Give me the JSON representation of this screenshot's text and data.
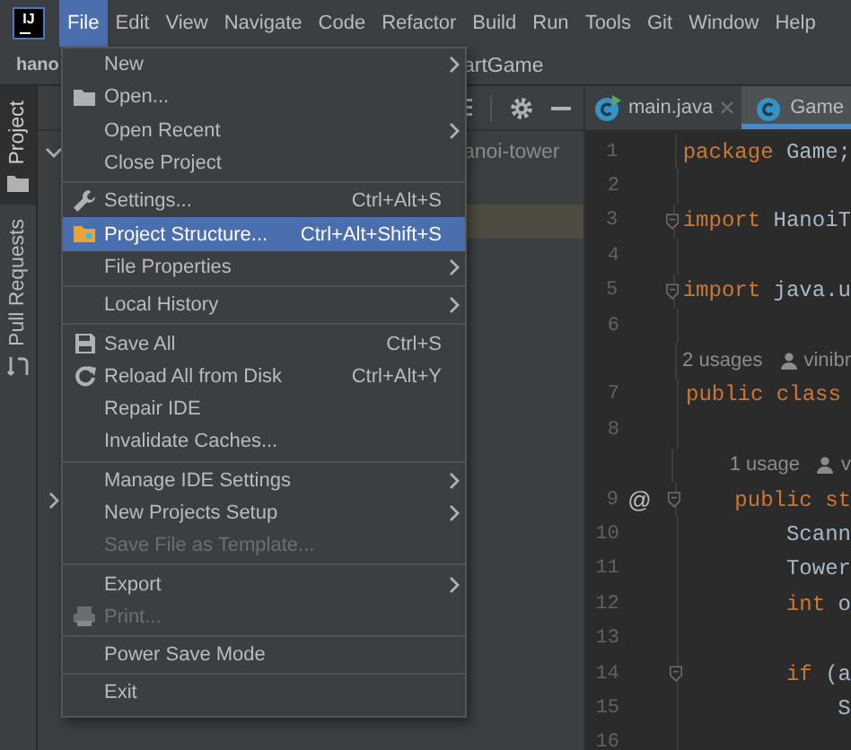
{
  "app": {
    "logo": "IJ"
  },
  "menu_bar": [
    {
      "label": "File",
      "selected": true
    },
    {
      "label": "Edit",
      "selected": false
    },
    {
      "label": "View",
      "selected": false
    },
    {
      "label": "Navigate",
      "selected": false
    },
    {
      "label": "Code",
      "selected": false
    },
    {
      "label": "Refactor",
      "selected": false
    },
    {
      "label": "Build",
      "selected": false
    },
    {
      "label": "Run",
      "selected": false
    },
    {
      "label": "Tools",
      "selected": false
    },
    {
      "label": "Git",
      "selected": false
    },
    {
      "label": "Window",
      "selected": false
    },
    {
      "label": "Help",
      "selected": false
    }
  ],
  "navigation_bar": {
    "project": "hano",
    "file": "artGame"
  },
  "tool_window_tabs": [
    {
      "label": "Project",
      "selected": true
    },
    {
      "label": "Pull Requests",
      "selected": false
    }
  ],
  "project_panel": {
    "rows": [
      {
        "label": "anoi-tower",
        "expanded": true,
        "selected": false
      },
      {
        "selected": false
      },
      {
        "selected": true
      },
      {
        "selected": false
      },
      {
        "selected": false
      },
      {
        "selected": false
      },
      {
        "selected": false
      },
      {
        "selected": false
      },
      {
        "selected": false
      },
      {
        "selected": false
      },
      {
        "expanded": false,
        "selected": false
      }
    ]
  },
  "editor": {
    "tabs": [
      {
        "label": "main.java",
        "selected": false,
        "runnable": true
      },
      {
        "label": "Game",
        "selected": true,
        "runnable": false
      }
    ],
    "lines": [
      {
        "kind": "code",
        "number": "1",
        "fold": false,
        "tokens": [
          {
            "text": "package",
            "kind": "keyword"
          },
          {
            "text": "Game;",
            "kind": "plain"
          }
        ]
      },
      {
        "kind": "code",
        "number": "2",
        "fold": false
      },
      {
        "kind": "code",
        "number": "3",
        "fold": true,
        "tokens": [
          {
            "text": "import",
            "kind": "keyword"
          },
          {
            "text": "HanoiT",
            "kind": "plain"
          }
        ]
      },
      {
        "kind": "code",
        "number": "4",
        "fold": false
      },
      {
        "kind": "code",
        "number": "5",
        "fold": true,
        "tokens": [
          {
            "text": "import",
            "kind": "keyword"
          },
          {
            "text": "java.u",
            "kind": "plain"
          }
        ]
      },
      {
        "kind": "code",
        "number": "6",
        "fold": false
      },
      {
        "kind": "hint",
        "usages": "2 usages",
        "author": "vinibr"
      },
      {
        "kind": "code",
        "number": "7",
        "fold": false,
        "tokens": [
          {
            "text": "public",
            "kind": "keyword"
          },
          {
            "text": "class",
            "kind": "keyword"
          }
        ],
        "children": [
          {
            "kind": "code",
            "number": "8",
            "fold": false
          },
          {
            "kind": "hint",
            "usages": "1 usage",
            "author": "v"
          },
          {
            "kind": "code",
            "number": "9",
            "fold": true,
            "annotation": "@",
            "tokens": [
              {
                "text": "public",
                "kind": "keyword"
              },
              {
                "text": "st",
                "kind": "keyword"
              }
            ],
            "children": [
              {
                "kind": "code",
                "number": "10",
                "fold": false,
                "tokens": [
                  {
                    "text": "Scann",
                    "kind": "plain"
                  }
                ]
              },
              {
                "kind": "code",
                "number": "11",
                "fold": false,
                "tokens": [
                  {
                    "text": "Tower",
                    "kind": "plain"
                  }
                ]
              },
              {
                "kind": "code",
                "number": "12",
                "fold": false,
                "tokens": [
                  {
                    "text": "int",
                    "kind": "keyword"
                  },
                  {
                    "text": "o",
                    "kind": "plain"
                  }
                ]
              },
              {
                "kind": "code",
                "number": "13",
                "fold": false
              },
              {
                "kind": "code",
                "number": "14",
                "fold": true,
                "tokens": [
                  {
                    "text": "if",
                    "kind": "keyword"
                  },
                  {
                    "text": "(a",
                    "kind": "plain"
                  }
                ],
                "children": [
                  {
                    "kind": "code",
                    "number": "15",
                    "fold": false,
                    "tokens": [
                      {
                        "text": "S",
                        "kind": "plain"
                      }
                    ]
                  },
                  {
                    "kind": "code",
                    "number": "16",
                    "fold": false
                  }
                ]
              }
            ]
          }
        ]
      }
    ]
  },
  "file_menu": {
    "sections": [
      [
        {
          "label": "New",
          "submenu": true,
          "selected": false,
          "disabled": false
        },
        {
          "label": "Open...",
          "submenu": false,
          "selected": false,
          "disabled": false
        },
        {
          "label": "Open Recent",
          "submenu": true,
          "selected": false,
          "disabled": false
        },
        {
          "label": "Close Project",
          "submenu": false,
          "selected": false,
          "disabled": false
        }
      ],
      [
        {
          "label": "Settings...",
          "shortcut": "Ctrl+Alt+S",
          "submenu": false,
          "selected": false,
          "disabled": false
        },
        {
          "label": "Project Structure...",
          "shortcut": "Ctrl+Alt+Shift+S",
          "submenu": false,
          "selected": true,
          "disabled": false
        },
        {
          "label": "File Properties",
          "submenu": true,
          "selected": false,
          "disabled": false
        }
      ],
      [
        {
          "label": "Local History",
          "submenu": true,
          "selected": false,
          "disabled": false
        }
      ],
      [
        {
          "label": "Save All",
          "shortcut": "Ctrl+S",
          "submenu": false,
          "selected": false,
          "disabled": false
        },
        {
          "label": "Reload All from Disk",
          "shortcut": "Ctrl+Alt+Y",
          "submenu": false,
          "selected": false,
          "disabled": false
        },
        {
          "label": "Repair IDE",
          "submenu": false,
          "selected": false,
          "disabled": false
        },
        {
          "label": "Invalidate Caches...",
          "submenu": false,
          "selected": false,
          "disabled": false
        }
      ],
      [
        {
          "label": "Manage IDE Settings",
          "submenu": true,
          "selected": false,
          "disabled": false
        },
        {
          "label": "New Projects Setup",
          "submenu": true,
          "selected": false,
          "disabled": false
        },
        {
          "label": "Save File as Template...",
          "submenu": false,
          "selected": false,
          "disabled": true
        }
      ],
      [
        {
          "label": "Export",
          "submenu": true,
          "selected": false,
          "disabled": false
        },
        {
          "label": "Print...",
          "submenu": false,
          "selected": false,
          "disabled": true
        }
      ],
      [
        {
          "label": "Power Save Mode",
          "submenu": false,
          "selected": false,
          "disabled": false
        }
      ],
      [
        {
          "label": "Exit",
          "submenu": false,
          "selected": false,
          "disabled": false
        }
      ]
    ]
  }
}
